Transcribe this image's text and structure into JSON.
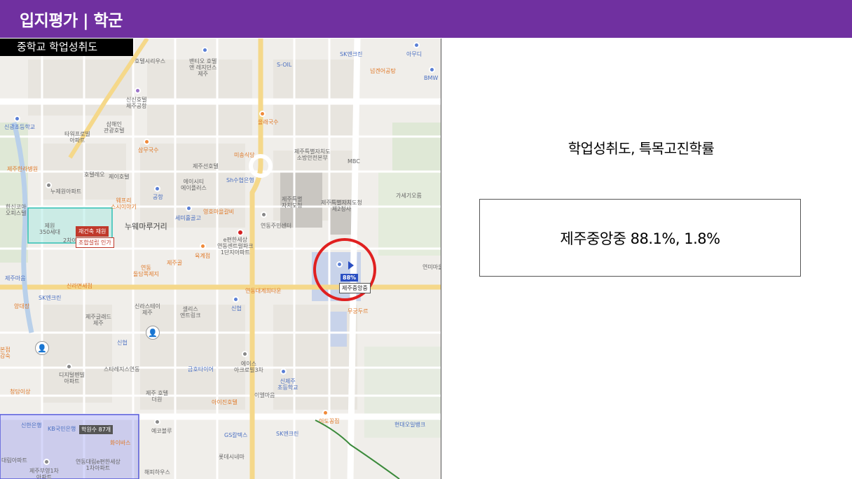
{
  "header": {
    "title": "입지평가 | 학군"
  },
  "map": {
    "label": "중학교 학업성취도",
    "target_school": {
      "name": "제주중앙중",
      "score_badge": "88%"
    },
    "highlight_color": "#e02020",
    "redevelopment": {
      "line1": "재건축 재원",
      "line2": "조합설립 인가"
    },
    "zone_badge": "학원수 87개",
    "pois": {
      "p1": "SK엔크린",
      "p2": "아무디",
      "p3": "S-OIL",
      "p4": "넘겐어공탕",
      "p5": "BMW",
      "p6": "호텔시리우스",
      "p7": "밴티오 호텔\n앤 레지던스\n제주",
      "p8": "신신호텔\n제주공항",
      "p9": "신광초등학교",
      "p10": "삼해인\n관광호텔",
      "p11": "타워프로빌\n아파트",
      "p12": "올래국수",
      "p13": "제주특별자치도\n소방안전본부",
      "p14": "MBC",
      "p15": "삼무국수",
      "p16": "제주한라병원",
      "p17": "호텔레오",
      "p18": "제이호텔",
      "p19": "제주선호텔",
      "p20": "미송식당",
      "p21": "Sh수협은행",
      "p22": "가세기오름",
      "p23": "누제원아파트",
      "p24": "에이시티\n에이플러스",
      "p25": "공항",
      "p26": "제주특별\n자치도청",
      "p27": "제주특별자치도청\n제2청사",
      "p28": "웨프리\n스시이야기",
      "p29": "한신코아\n오피스텔",
      "p30": "영호마을갈비",
      "p31": "세미홀골고",
      "p32": "연동주민센터",
      "p33": "누웨마루거리",
      "p34": "e편한세상\n연동센트럴파크\n1단지아파트",
      "p35": "연미마을",
      "p36": "제주골",
      "p37": "육계점",
      "p38": "연동\n돌담쪽제지",
      "p39": "제주마음",
      "p40": "신라면세점",
      "p41": "연동대계희타운",
      "p42": "SK엔크린",
      "p43": "양대장",
      "p44": "신라스테이\n제주",
      "p45": "셀리스\n엔트링크",
      "p46": "신협",
      "p47": "제주글래드\n제주",
      "p48": "무궁두르",
      "p49": "신협",
      "p50": "스타레지스연동",
      "p51": "금호타이어",
      "p52": "에이스\n아크로빌3차",
      "p53": "디지털펜빌\n아파트",
      "p54": "제주 호텔\n더원",
      "p55": "아이진호텔",
      "p56": "신제주\n초등학교",
      "p57": "이엘마음",
      "p58": "청담이상",
      "p59": "신한은행",
      "p60": "KB국민은행",
      "p61": "화이바스",
      "p62": "예코블루",
      "p63": "GS칼텍스",
      "p64": "SK엔크린",
      "p65": "이도꽁집",
      "p66": "현대오일뱅크",
      "p67": "롯데시네마",
      "p68": "연동대림e편한세상\n1차아파트",
      "p69": "제주부영1차\n아파트",
      "p70": "해피하우스",
      "p71": "대림아파트",
      "p72": "제원\n350세대",
      "p73": "2차아파트",
      "p74": "본점\n감숙"
    }
  },
  "right": {
    "heading": "학업성취도, 특목고진학률",
    "result": "제주중앙중 88.1%, 1.8%"
  }
}
